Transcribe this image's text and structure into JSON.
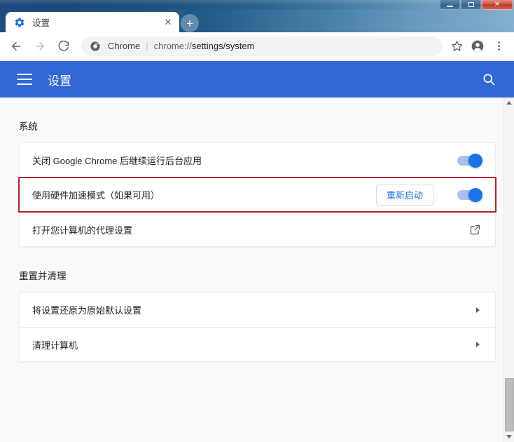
{
  "window": {
    "minimize_label": "—",
    "maximize_label": "□",
    "close_label": "✕"
  },
  "browser": {
    "tab": {
      "title": "设置",
      "favicon": "gear-icon",
      "close_label": "✕"
    },
    "new_tab_label": "+",
    "nav": {
      "back_label": "←",
      "forward_label": "→",
      "reload_label": "⟳"
    },
    "omnibox": {
      "site_label": "Chrome",
      "separator": "|",
      "url_prefix": "chrome://",
      "url_emphasis": "settings/system"
    },
    "actions": {
      "bookmark": "star-icon",
      "profile": "account-avatar-icon",
      "menu": "three-dot-menu-icon"
    }
  },
  "settings_header": {
    "menu_label": "hamburger-menu",
    "title": "设置",
    "search_label": "search-icon"
  },
  "sections": [
    {
      "title": "系统",
      "rows": [
        {
          "label": "关闭 Google Chrome 后继续运行后台应用",
          "control": "toggle",
          "toggle_on": true,
          "highlighted": false
        },
        {
          "label": "使用硬件加速模式（如果可用）",
          "control": "toggle-with-button",
          "button_label": "重新启动",
          "toggle_on": true,
          "highlighted": true
        },
        {
          "label": "打开您计算机的代理设置",
          "control": "external-link",
          "highlighted": false
        }
      ]
    },
    {
      "title": "重置并清理",
      "rows": [
        {
          "label": "将设置还原为原始默认设置",
          "control": "chevron",
          "highlighted": false
        },
        {
          "label": "清理计算机",
          "control": "chevron",
          "highlighted": false
        }
      ]
    }
  ],
  "colors": {
    "accent_blue": "#1a73e8",
    "header_blue": "#3367d6",
    "highlight_red": "#b3232c",
    "page_background": "#f8f9fa"
  }
}
